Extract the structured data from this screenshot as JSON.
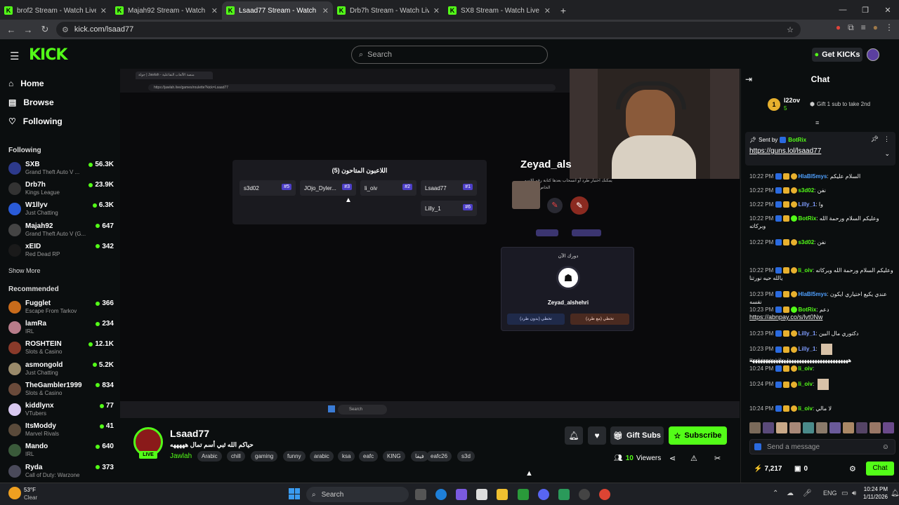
{
  "browser": {
    "tabs": [
      {
        "title": "brof2 Stream - Watch Live on K",
        "active": false
      },
      {
        "title": "Majah92 Stream - Watch Live o",
        "active": false
      },
      {
        "title": "Lsaad77 Stream - Watch Live o",
        "active": true
      },
      {
        "title": "Drb7h Stream - Watch Live on K",
        "active": false
      },
      {
        "title": "SX8 Stream - Watch Live on Kic",
        "active": false
      }
    ],
    "url": "kick.com/lsaad77"
  },
  "header": {
    "logo": "KICK",
    "search_placeholder": "Search",
    "get_kicks": "Get KICKs"
  },
  "sidebar": {
    "nav": [
      {
        "label": "Home",
        "icon": "home-icon"
      },
      {
        "label": "Browse",
        "icon": "browse-icon"
      },
      {
        "label": "Following",
        "icon": "heart-icon"
      }
    ],
    "following_title": "Following",
    "following": [
      {
        "name": "SXB",
        "category": "Grand Theft Auto V ...",
        "viewers": "56.3K",
        "color": "#2d3a8c"
      },
      {
        "name": "Drb7h",
        "category": "Kings League",
        "viewers": "23.9K",
        "color": "#333333"
      },
      {
        "name": "W1llyv",
        "category": "Just Chatting",
        "viewers": "6.3K",
        "color": "#2a5bd7"
      },
      {
        "name": "Majah92",
        "category": "Grand Theft Auto V (G...",
        "viewers": "647",
        "color": "#444444"
      },
      {
        "name": "xEID",
        "category": "Red Dead RP",
        "viewers": "342",
        "color": "#1a1a1a"
      }
    ],
    "show_more": "Show More",
    "recommended_title": "Recommended",
    "recommended": [
      {
        "name": "Fugglet",
        "category": "Escape From Tarkov",
        "viewers": "366",
        "color": "#c86b1b"
      },
      {
        "name": "lamRa",
        "category": "IRL",
        "viewers": "234",
        "color": "#b77c8a"
      },
      {
        "name": "ROSHTEIN",
        "category": "Slots & Casino",
        "viewers": "12.1K",
        "color": "#8a3a2a"
      },
      {
        "name": "asmongold",
        "category": "Just Chatting",
        "viewers": "5.2K",
        "color": "#9a8a6a"
      },
      {
        "name": "TheGambler1999",
        "category": "Slots & Casino",
        "viewers": "834",
        "color": "#6a4a3a"
      },
      {
        "name": "kiddlynx",
        "category": "VTubers",
        "viewers": "77",
        "color": "#d8c8f0"
      },
      {
        "name": "ItsModdy",
        "category": "Marvel Rivals",
        "viewers": "41",
        "color": "#5a4a3a"
      },
      {
        "name": "Mando",
        "category": "IRL",
        "viewers": "640",
        "color": "#3a5a3a"
      },
      {
        "name": "Ryda",
        "category": "Call of Duty: Warzone",
        "viewers": "373",
        "color": "#4a4a5a"
      }
    ]
  },
  "video": {
    "inner_tab": "جولة | Jawlah - منصة الألعاب التفاعلية",
    "inner_url": "https://jawlah.live/games/roulette?kick=Lsaad77",
    "players_title": "اللاعبون المتاحون (5)",
    "players": [
      {
        "name": "s3d02",
        "rank": "#5"
      },
      {
        "name": "JOjo_Dyler...",
        "rank": "#3"
      },
      {
        "name": "li_oiv",
        "rank": "#2"
      },
      {
        "name": "Lsaad77",
        "rank": "#1"
      },
      {
        "name": "Lilly_1",
        "rank": "#6"
      }
    ],
    "side_name": "Zeyad_als",
    "side_text": "يمكنك اختيار طرد أو انسحاب بعدها كتابة رقم الاسم",
    "side_text2": "الخاص به",
    "your_turn": "دورك الآن",
    "turn_player": "Zeyad_alshehri",
    "btn_skip": "تخطي (بدون طرد)",
    "btn_kick": "تخطي (مع طرد)",
    "inner_search": "Search"
  },
  "stream": {
    "name": "Lsaad77",
    "title": "حياكم الله ثبي أسم تمال هههههه",
    "live": "LIVE",
    "category": "Jawlah",
    "tags": [
      "Arabic",
      "chill",
      "gaming",
      "funny",
      "arabic",
      "ksa",
      "eafc",
      "KING",
      "فيفا",
      "eafc26",
      "s3d"
    ],
    "gift_subs": "Gift Subs",
    "subscribe": "Subscribe",
    "viewers_count": "10",
    "viewers_label": "Viewers"
  },
  "chat": {
    "title": "Chat",
    "top_gifter": "l22ov",
    "top_gifter_count": "5",
    "gift_prompt": "Gift 1 sub to take 2nd",
    "pinned_by_label": "Sent by",
    "pinned_by": "BotRix",
    "pinned_link": "https://guns.lol/lsaad77",
    "messages": [
      {
        "time": "10:22 PM",
        "user": "HlaBl5mys",
        "color": "#4fa0ff",
        "text": "السلام عليكم"
      },
      {
        "time": "10:22 PM",
        "user": "s3d02",
        "color": "#53fc18",
        "text": "نفن"
      },
      {
        "time": "10:22 PM",
        "user": "Lilly_1",
        "color": "#7f9cff",
        "text": "وا"
      },
      {
        "time": "10:22 PM",
        "user": "BotRix",
        "color": "#53fc18",
        "text": "وعليكم السلام ورحمة الله وبركاته"
      },
      {
        "time": "10:22 PM",
        "user": "s3d02",
        "color": "#53fc18",
        "text": "نفن"
      },
      {
        "time": "10:22 PM",
        "user": "li_oiv",
        "color": "#53fc18",
        "text": "وعليكم السلام ورحمة الله وبركاته يالله حيه نورتنا"
      },
      {
        "time": "10:23 PM",
        "user": "HlaBl5mys",
        "color": "#4fa0ff",
        "text": "عندي يكيع اختياري ايكون نفسه"
      },
      {
        "time": "10:23 PM",
        "user": "BotRix",
        "color": "#53fc18",
        "text": "دعم"
      },
      {
        "time": "10:23 PM",
        "user": "Lilly_1",
        "color": "#7f9cff",
        "text": "دكتوري مال البين"
      },
      {
        "time": "10:23 PM",
        "user": "Lilly_1",
        "color": "#7f9cff",
        "text": ""
      },
      {
        "time": "10:24 PM",
        "user": "li_oiv",
        "color": "#53fc18",
        "text": ""
      },
      {
        "time": "10:24 PM",
        "user": "li_oiv",
        "color": "#53fc18",
        "text": ""
      },
      {
        "time": "10:24 PM",
        "user": "li_oiv",
        "color": "#53fc18",
        "text": "لا مالي"
      }
    ],
    "botrix_link": "https://abnpay.co/s/lvt0Nw",
    "reply_to": "Replying to Lilly_1:",
    "long_line": "ههههههههههههههههههههههههههههههههههههههه",
    "input_placeholder": "Send a message",
    "kicks": "7,217",
    "gifts": "0",
    "chat_button": "Chat"
  },
  "taskbar": {
    "weather_temp": "53°F",
    "weather_desc": "Clear",
    "search": "Search",
    "lang": "ENG",
    "time": "10:24 PM",
    "date": "1/11/2026"
  }
}
